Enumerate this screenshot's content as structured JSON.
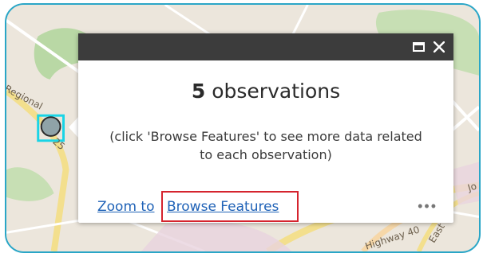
{
  "popup": {
    "count": "5",
    "title_suffix": " observations",
    "description": "(click 'Browse Features' to see more data related to each observation)",
    "zoom_link": "Zoom to",
    "browse_link": "Browse Features",
    "more_label": "•••",
    "maximize_icon": "maximize-icon",
    "close_icon": "close-icon"
  },
  "map": {
    "labels": {
      "regional": "Regional",
      "road_25": "25",
      "highway": "Highway 40",
      "east": "East",
      "jo": "Jo"
    }
  },
  "colors": {
    "header": "#3c3c3c",
    "link": "#1f62b7",
    "highlight": "#d5242e",
    "frame": "#2aa6c7",
    "marker_selection": "#19d4e6"
  }
}
